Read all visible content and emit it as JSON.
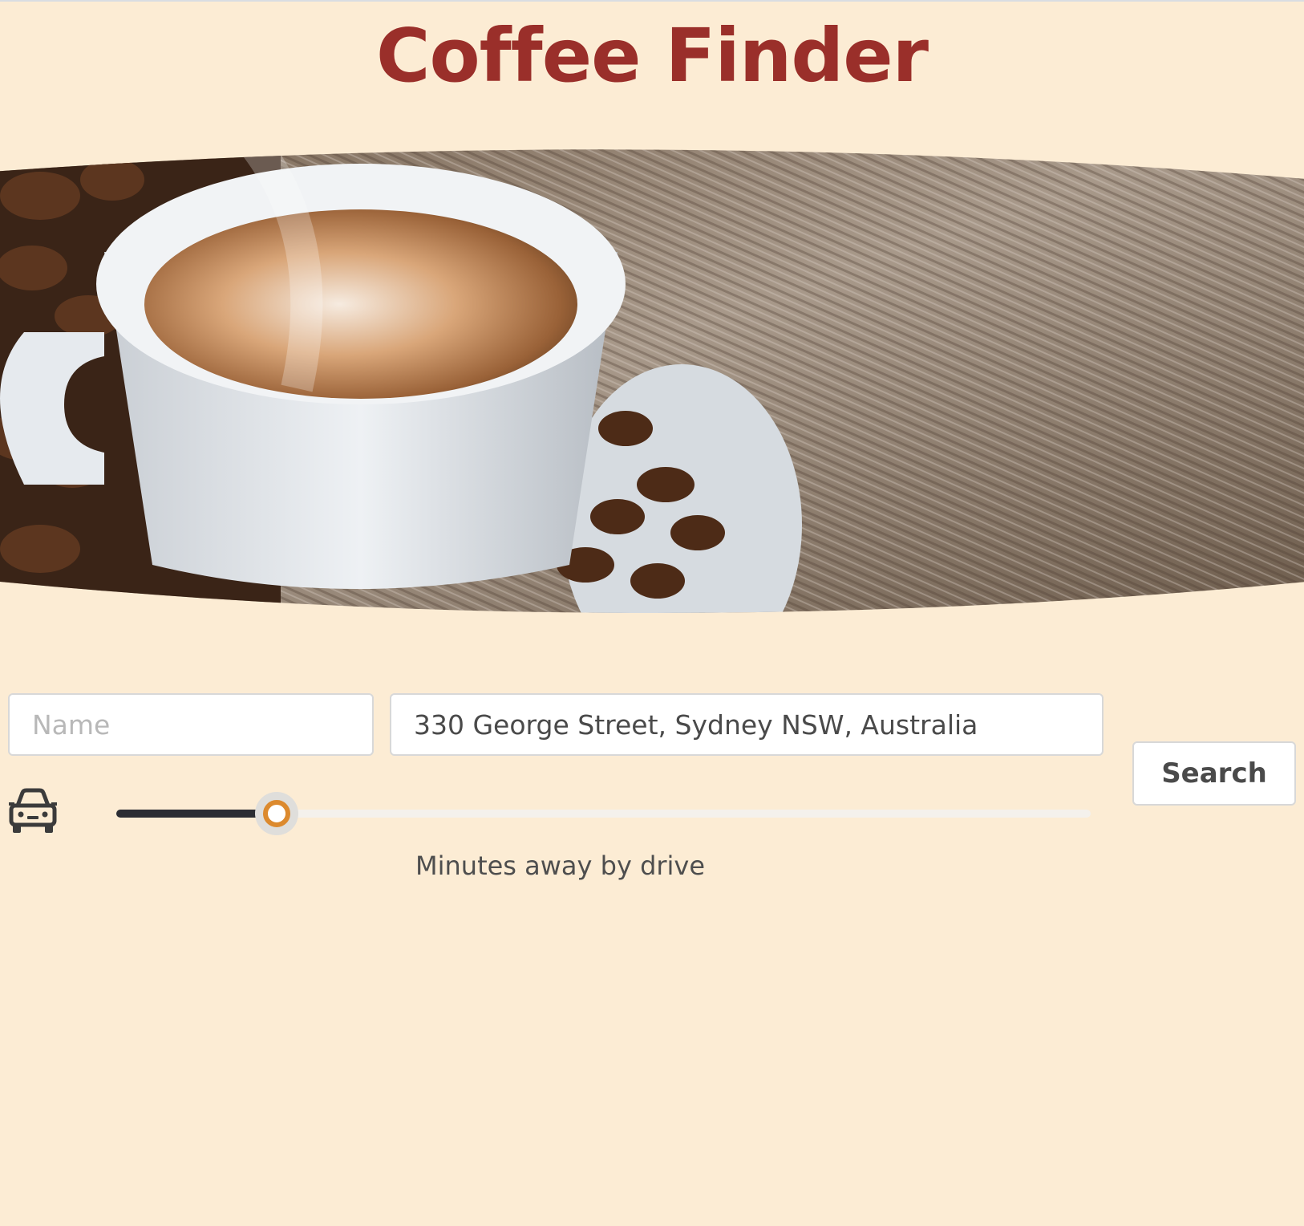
{
  "header": {
    "title": "Coffee Finder"
  },
  "hero": {
    "image": "coffee-cup-on-wooden-table"
  },
  "search": {
    "name_placeholder": "Name",
    "name_value": "",
    "location_value": "330 George Street, Sydney NSW, Australia",
    "button_label": "Search"
  },
  "drive": {
    "icon": "car-icon",
    "slider_fraction": 0.165,
    "caption": "Minutes away by drive"
  },
  "colors": {
    "background": "#fcecd4",
    "title": "#9a2f2a",
    "slider_fill": "#2b2d33",
    "slider_thumb_ring": "#dc8a2e"
  }
}
